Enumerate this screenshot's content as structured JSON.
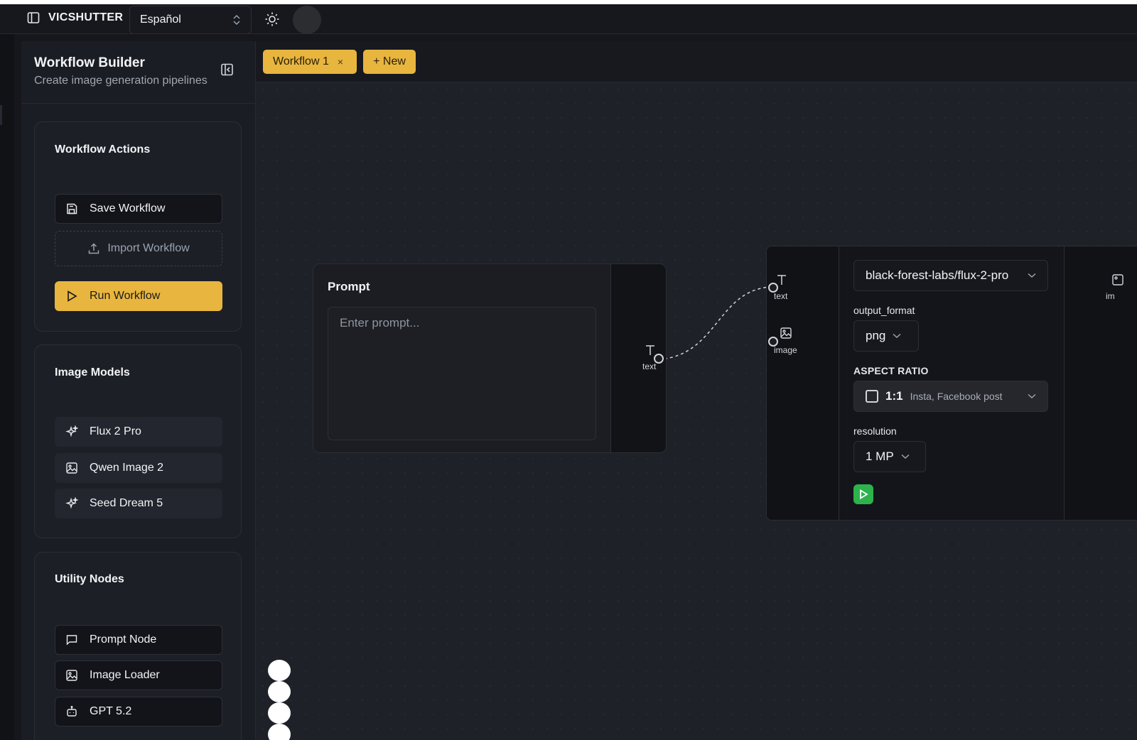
{
  "header": {
    "app_name": "VICSHUTTER",
    "language": "Español"
  },
  "sidebar": {
    "title": "Workflow Builder",
    "subtitle": "Create image generation pipelines",
    "workflow_actions": {
      "title": "Workflow Actions",
      "save": "Save Workflow",
      "import": "Import Workflow",
      "run": "Run Workflow"
    },
    "image_models": {
      "title": "Image Models",
      "items": [
        "Flux 2 Pro",
        "Qwen Image 2",
        "Seed Dream 5"
      ]
    },
    "utility_nodes": {
      "title": "Utility Nodes",
      "items": [
        "Prompt Node",
        "Image Loader",
        "GPT 5.2"
      ]
    }
  },
  "tabs": {
    "active": "Workflow 1",
    "close_glyph": "×",
    "new_label": "+ New"
  },
  "canvas": {
    "prompt_node": {
      "title": "Prompt",
      "placeholder": "Enter prompt...",
      "output_port": "text"
    },
    "model_node": {
      "input_ports": [
        "text",
        "image"
      ],
      "output_port": "im",
      "model": "black-forest-labs/flux-2-pro",
      "output_format_label": "output_format",
      "output_format": "png",
      "aspect_ratio_label": "ASPECT RATIO",
      "aspect_ratio": "1:1",
      "aspect_ratio_desc": "Insta, Facebook post",
      "resolution_label": "resolution",
      "resolution": "1 MP"
    }
  },
  "colors": {
    "accent": "#e8b53f",
    "run_green": "#2eb24c",
    "canvas_bg": "#1e2128"
  }
}
